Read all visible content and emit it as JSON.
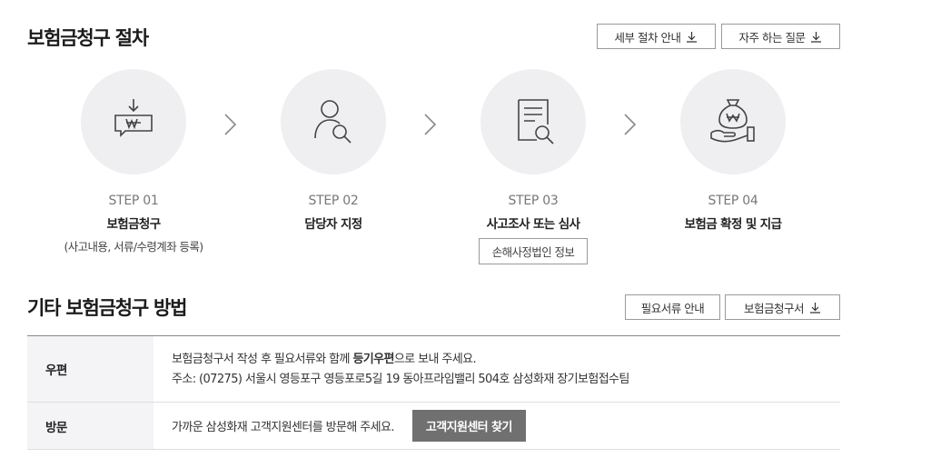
{
  "procedure": {
    "title": "보험금청구 절차",
    "detail_button": "세부 절차 안내",
    "faq_button": "자주 하는 질문",
    "steps": [
      {
        "no": "STEP 01",
        "name": "보험금청구",
        "sub": "(사고내용, 서류/수령계좌 등록)",
        "icon": "money-transfer-icon"
      },
      {
        "no": "STEP 02",
        "name": "담당자 지정",
        "icon": "person-search-icon"
      },
      {
        "no": "STEP 03",
        "name": "사고조사 또는 심사",
        "sub_button": "손해사정법인 정보",
        "icon": "document-review-icon"
      },
      {
        "no": "STEP 04",
        "name": "보험금 확정 및 지급",
        "icon": "money-bag-hand-icon"
      }
    ]
  },
  "other": {
    "title": "기타 보험금청구 방법",
    "docs_button": "필요서류 안내",
    "form_button": "보험금청구서",
    "rows": [
      {
        "label": "우편",
        "line1_pre": "보험금청구서 작성 후 필요서류와 함께 ",
        "line1_bold": "등기우편",
        "line1_post": "으로 보내 주세요.",
        "line2": "주소: (07275) 서울시 영등포구 영등포로5길 19 동아프라임밸리 504호 삼성화재 장기보험접수팀"
      },
      {
        "label": "방문",
        "text": "가까운 삼성화재 고객지원센터를 방문해 주세요.",
        "button": "고객지원센터 찾기"
      }
    ]
  }
}
